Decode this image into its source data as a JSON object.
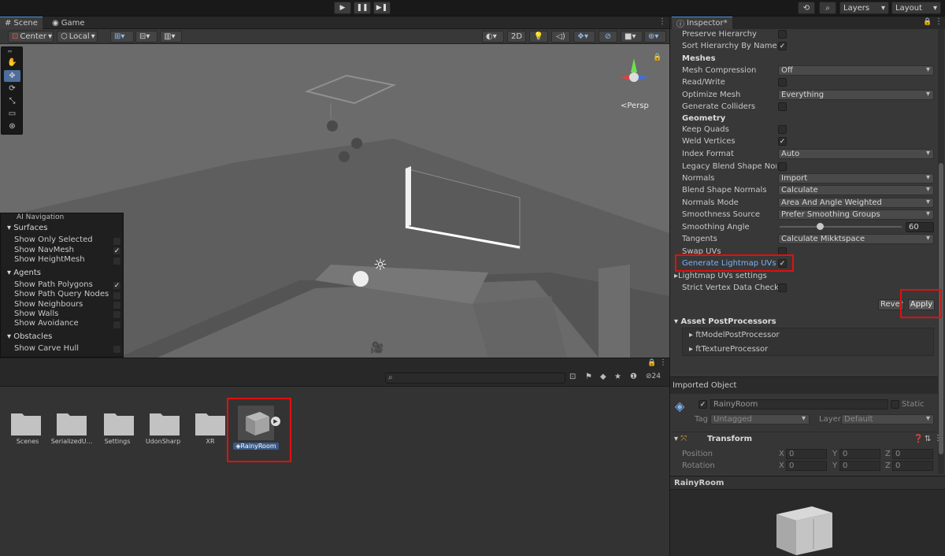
{
  "play_controls": {
    "play": "▶",
    "pause": "❚❚",
    "step": "▶❚"
  },
  "top_right": {
    "layers": "Layers",
    "layout": "Layout"
  },
  "tabs": [
    {
      "label": "Scene"
    },
    {
      "label": "Game"
    }
  ],
  "scene_toolbar": {
    "pivot": "Center",
    "space": "Local",
    "mode_2d": "2D",
    "persp": "<Persp"
  },
  "ai_navigation": {
    "title": "AI Navigation",
    "sections": [
      {
        "header": "Surfaces",
        "items": [
          {
            "label": "Show Only Selected",
            "checked": false
          },
          {
            "label": "Show NavMesh",
            "checked": true
          },
          {
            "label": "Show HeightMesh",
            "checked": false
          }
        ]
      },
      {
        "header": "Agents",
        "items": [
          {
            "label": "Show Path Polygons",
            "checked": true
          },
          {
            "label": "Show Path Query Nodes",
            "checked": false
          },
          {
            "label": "Show Neighbours",
            "checked": false
          },
          {
            "label": "Show Walls",
            "checked": false
          },
          {
            "label": "Show Avoidance",
            "checked": false
          }
        ]
      },
      {
        "header": "Obstacles",
        "items": [
          {
            "label": "Show Carve Hull",
            "checked": false
          }
        ]
      }
    ]
  },
  "project": {
    "hidden_count": "24",
    "assets": [
      {
        "label": "Scenes"
      },
      {
        "label": "SerializedU..."
      },
      {
        "label": "Settings"
      },
      {
        "label": "UdonSharp"
      },
      {
        "label": "XR"
      },
      {
        "label": "RainyRoom"
      }
    ]
  },
  "inspector": {
    "tab": "Inspector*",
    "rows": {
      "preserve_hierarchy": "Preserve Hierarchy",
      "sort_hierarchy": "Sort Hierarchy By Name",
      "meshes": "Meshes",
      "mesh_compression": "Mesh Compression",
      "mesh_compression_val": "Off",
      "read_write": "Read/Write",
      "optimize_mesh": "Optimize Mesh",
      "optimize_mesh_val": "Everything",
      "generate_colliders": "Generate Colliders",
      "geometry": "Geometry",
      "keep_quads": "Keep Quads",
      "weld_vertices": "Weld Vertices",
      "index_format": "Index Format",
      "index_format_val": "Auto",
      "legacy_blend": "Legacy Blend Shape Norma",
      "normals": "Normals",
      "normals_val": "Import",
      "blend_normals": "Blend Shape Normals",
      "blend_normals_val": "Calculate",
      "normals_mode": "Normals Mode",
      "normals_mode_val": "Area And Angle Weighted",
      "smoothness_source": "Smoothness Source",
      "smoothness_source_val": "Prefer Smoothing Groups",
      "smoothing_angle": "Smoothing Angle",
      "smoothing_angle_val": "60",
      "tangents": "Tangents",
      "tangents_val": "Calculate Mikktspace",
      "swap_uvs": "Swap UVs",
      "generate_lightmap": "Generate Lightmap UVs",
      "lightmap_settings": "Lightmap UVs settings",
      "strict_vertex": "Strict Vertex Data Checks",
      "revert": "Revert",
      "apply": "Apply"
    },
    "checks": {
      "preserve_hierarchy": false,
      "sort_hierarchy": true,
      "read_write": false,
      "generate_colliders": false,
      "keep_quads": false,
      "weld_vertices": true,
      "legacy_blend": false,
      "swap_uvs": false,
      "generate_lightmap": true,
      "strict_vertex": false
    },
    "smoothing_angle_fraction": 0.33,
    "post_processors": {
      "title": "Asset PostProcessors",
      "items": [
        "ftModelPostProcessor",
        "ftTextureProcessor"
      ]
    },
    "imported_object": {
      "title": "Imported Object",
      "name": "RainyRoom",
      "static": "Static",
      "tag_label": "Tag",
      "tag": "Untagged",
      "layer_label": "Layer",
      "layer": "Default",
      "transform": "Transform",
      "position": "Position",
      "rotation": "Rotation",
      "pos": {
        "x": "0",
        "y": "0",
        "z": "0"
      },
      "rot": {
        "x": "0",
        "y": "0",
        "z": "0"
      },
      "axis_x": "X",
      "axis_y": "Y",
      "axis_z": "Z"
    },
    "preview_title": "RainyRoom"
  },
  "colors": {
    "highlight": "#e01010",
    "accent": "#4d8fd4",
    "link_blue": "#7fb2f0"
  }
}
